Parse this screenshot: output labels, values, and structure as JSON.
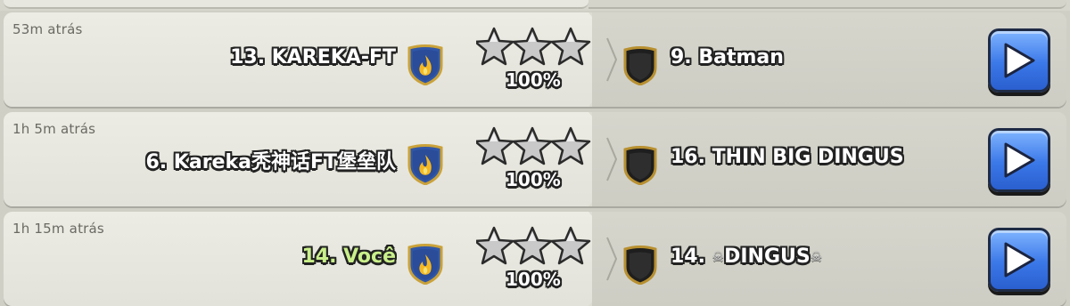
{
  "attacks": [
    {
      "time": "53m atrás",
      "attacker": "13. KAREKA-FT",
      "attacker_is_self": false,
      "stars": 3,
      "destruction": "100%",
      "defender_prefix": "9. Batman",
      "defender_skull_name": "",
      "replay_icon": "play-icon"
    },
    {
      "time": "1h 5m atrás",
      "attacker": "6. Kareka秃神话FT堡垒队",
      "attacker_is_self": false,
      "stars": 3,
      "destruction": "100%",
      "defender_prefix": "16. THIN BIG DINGUS",
      "defender_skull_name": "",
      "replay_icon": "play-icon"
    },
    {
      "time": "1h 15m atrás",
      "attacker": "14. Você",
      "attacker_is_self": true,
      "stars": 3,
      "destruction": "100%",
      "defender_prefix": "14. ",
      "defender_skull_name": "DINGUS",
      "replay_icon": "play-icon"
    }
  ],
  "colors": {
    "self_name": "#c9ef8a",
    "play_button": "#3b78e8",
    "star": "#c9c9c9",
    "attacker_badge": "#2f56a8"
  }
}
